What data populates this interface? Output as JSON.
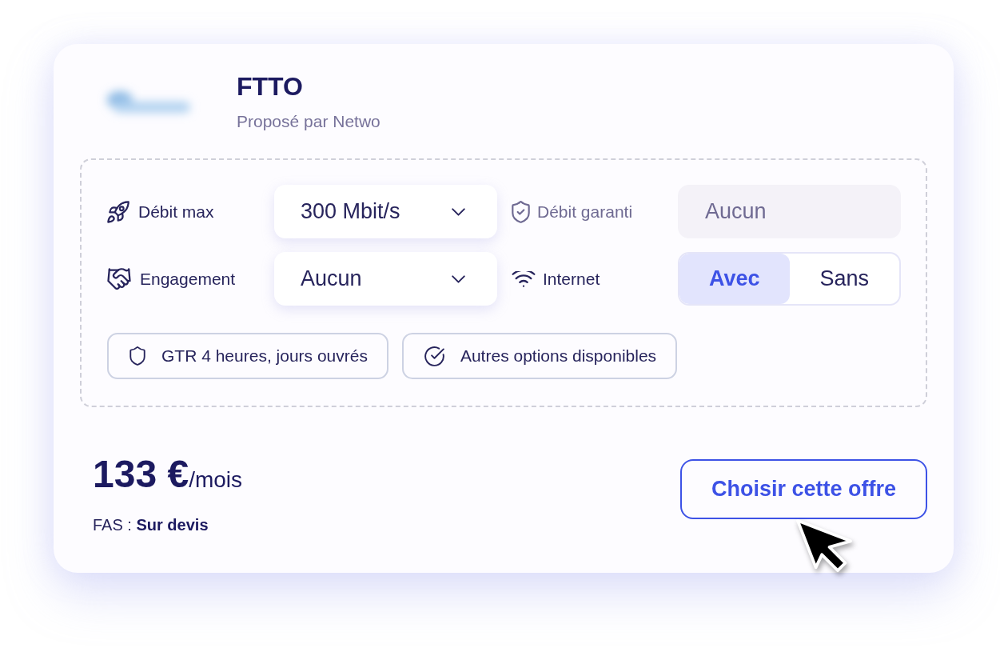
{
  "offer": {
    "title": "FTTO",
    "provider": "Proposé par Netwo"
  },
  "specs": [
    {
      "kind": "select",
      "label": "Débit max",
      "value": "300 Mbit/s",
      "disabled": false
    },
    {
      "kind": "input",
      "label": "Débit garanti",
      "value": "Aucun",
      "disabled": true
    },
    {
      "kind": "select",
      "label": "Engagement",
      "value": "Aucun",
      "disabled": false
    },
    {
      "kind": "toggle",
      "label": "Internet",
      "disabled": false,
      "options": [
        {
          "label": "Avec",
          "selected": true
        },
        {
          "label": "Sans",
          "selected": false
        }
      ]
    }
  ],
  "features": [
    {
      "label": "GTR 4 heures, jours ouvrés"
    },
    {
      "label": "Autres options disponibles"
    }
  ],
  "price": {
    "amount": "133 €",
    "period": "/mois",
    "setup_fee": "FAS : **Sur devis**"
  },
  "action": {
    "label": "Choisir cette offre"
  }
}
